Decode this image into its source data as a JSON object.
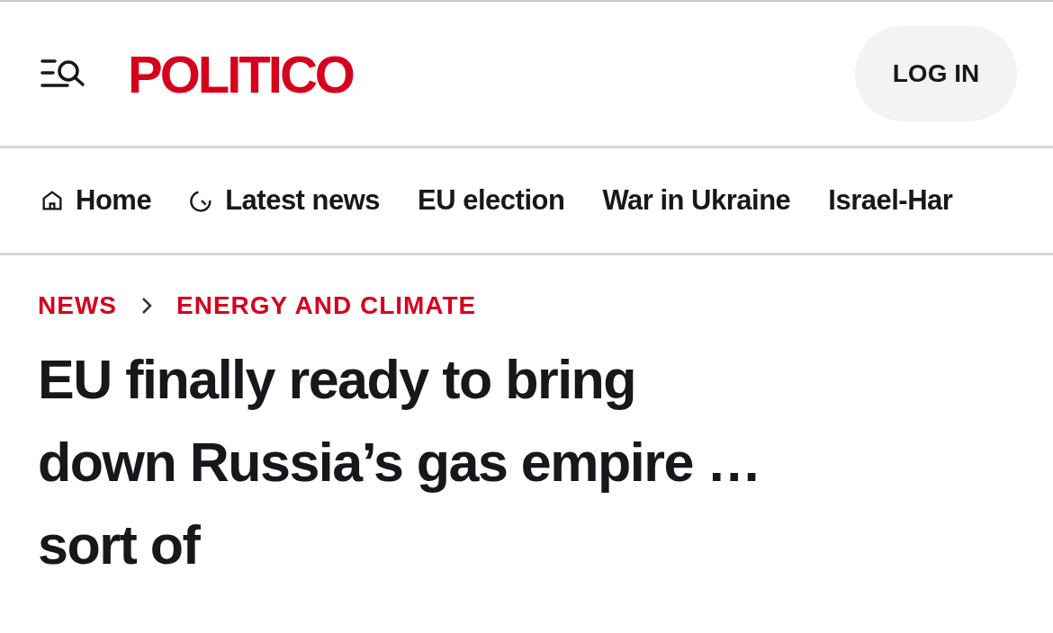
{
  "header": {
    "logo": "POLITICO",
    "login": "LOG IN"
  },
  "nav": [
    {
      "label": "Home",
      "kind": "home"
    },
    {
      "label": "Latest news",
      "kind": "clock"
    },
    {
      "label": "EU election",
      "kind": "plain"
    },
    {
      "label": "War in Ukraine",
      "kind": "plain"
    },
    {
      "label": "Israel-Har",
      "kind": "plain"
    }
  ],
  "breadcrumb": [
    "NEWS",
    "ENERGY AND CLIMATE"
  ],
  "headline": "EU finally ready to bring down Russia’s gas empire … sort of"
}
